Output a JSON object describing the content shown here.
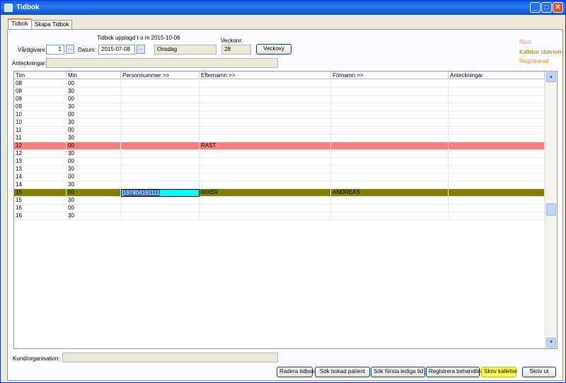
{
  "window": {
    "title": "Tidbok"
  },
  "tabs": [
    {
      "label": "Tidbok",
      "active": true
    },
    {
      "label": "Skapa Tidbok",
      "active": false
    }
  ],
  "header": {
    "upplagd_label": "Tidbok upplagd t o m 2015-10-06",
    "vardgivare_label": "Vårdgivare:",
    "vardgivare_value": "1",
    "datum_label": "Datum:",
    "datum_value": "2015-07-08",
    "weekday_value": "Onsdag",
    "veckonr_label": "Veckonr:",
    "veckonr_value": "28",
    "veckovy_button": "Veckovy",
    "anteckningar_label": "Anteckningar:",
    "anteckningar_value": ""
  },
  "legend": [
    {
      "label": "Rast",
      "color": "#ff8c8c"
    },
    {
      "label": "Kallelse utskriven",
      "color": "#808000"
    },
    {
      "label": "Registrerad",
      "color": "#ff8c00"
    }
  ],
  "grid": {
    "columns": [
      "Tim",
      "Min",
      "Personnummer >>",
      "Efternamn >>",
      "Förnamn >>",
      "Anteckningar"
    ],
    "rows": [
      {
        "tim": "08",
        "min": "00",
        "pnr": "",
        "efternamn": "",
        "fornamn": "",
        "ant": "",
        "status": ""
      },
      {
        "tim": "08",
        "min": "30",
        "pnr": "",
        "efternamn": "",
        "fornamn": "",
        "ant": "",
        "status": ""
      },
      {
        "tim": "09",
        "min": "00",
        "pnr": "",
        "efternamn": "",
        "fornamn": "",
        "ant": "",
        "status": ""
      },
      {
        "tim": "09",
        "min": "30",
        "pnr": "",
        "efternamn": "",
        "fornamn": "",
        "ant": "",
        "status": ""
      },
      {
        "tim": "10",
        "min": "00",
        "pnr": "",
        "efternamn": "",
        "fornamn": "",
        "ant": "",
        "status": ""
      },
      {
        "tim": "10",
        "min": "30",
        "pnr": "",
        "efternamn": "",
        "fornamn": "",
        "ant": "",
        "status": ""
      },
      {
        "tim": "11",
        "min": "00",
        "pnr": "",
        "efternamn": "",
        "fornamn": "",
        "ant": "",
        "status": ""
      },
      {
        "tim": "11",
        "min": "30",
        "pnr": "",
        "efternamn": "",
        "fornamn": "",
        "ant": "",
        "status": ""
      },
      {
        "tim": "12",
        "min": "00",
        "pnr": "",
        "efternamn": "RAST",
        "fornamn": "",
        "ant": "",
        "status": "rast"
      },
      {
        "tim": "12",
        "min": "30",
        "pnr": "",
        "efternamn": "",
        "fornamn": "",
        "ant": "",
        "status": ""
      },
      {
        "tim": "13",
        "min": "00",
        "pnr": "",
        "efternamn": "",
        "fornamn": "",
        "ant": "",
        "status": ""
      },
      {
        "tim": "13",
        "min": "30",
        "pnr": "",
        "efternamn": "",
        "fornamn": "",
        "ant": "",
        "status": ""
      },
      {
        "tim": "14",
        "min": "00",
        "pnr": "",
        "efternamn": "",
        "fornamn": "",
        "ant": "",
        "status": ""
      },
      {
        "tim": "14",
        "min": "30",
        "pnr": "",
        "efternamn": "",
        "fornamn": "",
        "ant": "",
        "status": ""
      },
      {
        "tim": "15",
        "min": "00",
        "pnr": "197804161111",
        "efternamn": "RIXER",
        "fornamn": "ANDREAS",
        "ant": "",
        "status": "kalled",
        "selected": true
      },
      {
        "tim": "15",
        "min": "30",
        "pnr": "",
        "efternamn": "",
        "fornamn": "",
        "ant": "",
        "status": ""
      },
      {
        "tim": "16",
        "min": "00",
        "pnr": "",
        "efternamn": "",
        "fornamn": "",
        "ant": "",
        "status": ""
      },
      {
        "tim": "16",
        "min": "30",
        "pnr": "",
        "efternamn": "",
        "fornamn": "",
        "ant": "",
        "status": ""
      }
    ]
  },
  "footer": {
    "kund_label": "Kund/organisation:",
    "kund_value": "",
    "buttons": {
      "radera": "Radera tidbok",
      "sok_bokad": "Sök bokad patient",
      "sok_forsta": "Sök första lediga tid",
      "registrera": "Registrera behandling",
      "skriv_kallelse": "Skriv kallelse",
      "skriv_ut": "Skriv ut"
    }
  }
}
